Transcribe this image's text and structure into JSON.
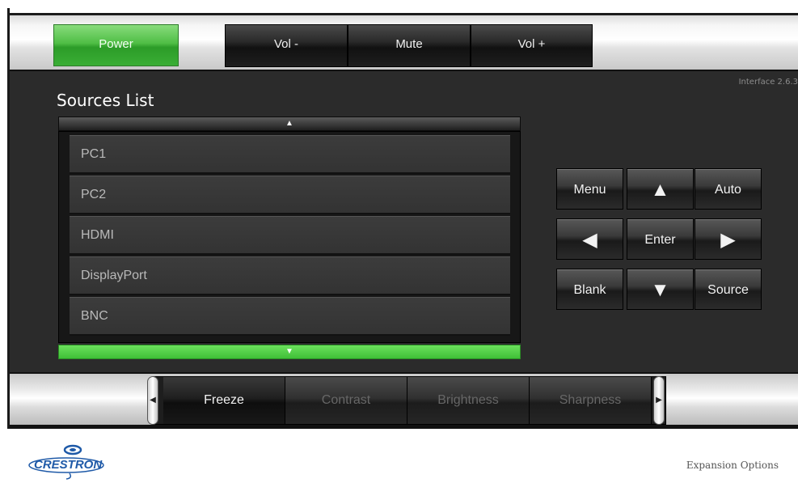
{
  "top": {
    "indicator_level": 0.5,
    "power_label": "Power",
    "vol_minus_label": "Vol -",
    "mute_label": "Mute",
    "vol_plus_label": "Vol +"
  },
  "main": {
    "interface_version": "Interface 2.6.3",
    "sources_title": "Sources List",
    "list_up_glyph": "▲",
    "list_down_glyph": "▼",
    "sources": [
      "PC1",
      "PC2",
      "HDMI",
      "DisplayPort",
      "BNC"
    ]
  },
  "keypad": {
    "menu": "Menu",
    "up": "▲",
    "auto": "Auto",
    "left": "◀",
    "enter": "Enter",
    "right": "▶",
    "blank": "Blank",
    "down": "▼",
    "source": "Source"
  },
  "adjust": {
    "left_arrow": "◀",
    "right_arrow": "▶",
    "items": [
      "Freeze",
      "Contrast",
      "Brightness",
      "Sharpness"
    ],
    "active_index": 0
  },
  "footer": {
    "logo_text": "CRESTRON",
    "expansion_label": "Expansion Options"
  },
  "colors": {
    "accent_green": "#4fbe45",
    "panel_dark": "#2b2b2b"
  }
}
